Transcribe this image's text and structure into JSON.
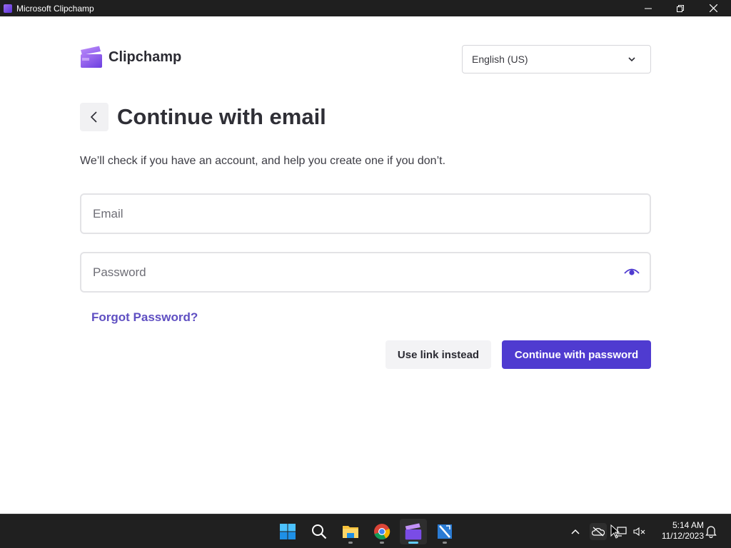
{
  "window": {
    "title": "Microsoft Clipchamp"
  },
  "brand": {
    "name": "Clipchamp"
  },
  "language": {
    "selected": "English (US)"
  },
  "page": {
    "title": "Continue with email",
    "subtitle": "We’ll check if you have an account, and help you create one if you don’t."
  },
  "form": {
    "email_placeholder": "Email",
    "email_value": "",
    "password_placeholder": "Password",
    "password_value": "",
    "forgot_label": "Forgot Password?"
  },
  "actions": {
    "secondary_label": "Use link instead",
    "primary_label": "Continue with password"
  },
  "taskbar": {
    "items": [
      "start-icon",
      "search-icon",
      "file-explorer-icon",
      "chrome-icon",
      "clipchamp-icon",
      "notepad-plus-plus-icon"
    ],
    "active": "clipchamp-icon"
  },
  "tray": {
    "time": "5:14 AM",
    "date": "11/12/2023"
  },
  "colors": {
    "accent": "#4f3bd0",
    "link": "#5f4fc2",
    "titlebar": "#1f1f1f",
    "taskbar": "#202020"
  }
}
